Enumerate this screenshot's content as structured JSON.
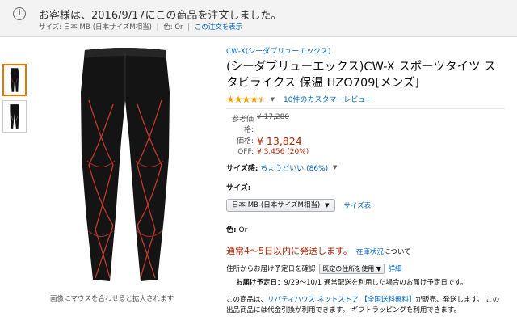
{
  "notice": {
    "icon": "info-icon",
    "message": "お客様は、2016/9/17にこの商品を注文しました。",
    "detail_size": "サイズ: 日本 MB-(日本サイズM相当)",
    "detail_sep": "|",
    "detail_color": "色: Or",
    "detail_link": "この注文を表示"
  },
  "gallery": {
    "hover_hint": "画像にマウスを合わせると拡大されます"
  },
  "product": {
    "brand": "CW-X(シーダブリューエックス)",
    "title": "(シーダブリューエックス)CW-X スポーツタイツ スタビライクス 保温 HZO709[メンズ]",
    "rating": 4.5,
    "reviews_text": "10件のカスタマーレビュー",
    "list_price_label": "参考価格:",
    "list_price": "¥ 17,280",
    "price_label": "価格:",
    "price": "¥ 13,824",
    "off_label": "OFF:",
    "off_value": "¥ 3,456 (20%)",
    "size_fit_label": "サイズ感:",
    "size_fit_value": "ちょうどいい (86%)",
    "size_label": "サイズ:",
    "size_selected": "日本 MB-(日本サイズM相当)",
    "size_chart_link": "サイズ表",
    "color_label": "色:",
    "color_value": "Or",
    "ship_message": "通常4～5日以内に発送します。",
    "stock_link": "在庫状況",
    "stock_tail": "について",
    "delivery_prefix": "住所からお届け予定日を確認",
    "delivery_select": "既定の住所を使用",
    "delivery_detail_link": "詳細",
    "delivery_date_label": "お届け予定日：",
    "delivery_date_text": "9/29～10/1 通常配送を利用した場合のお届け予定日です。",
    "seller_text_1": "この商品は、",
    "seller_name": "リバティハウス ネットストア",
    "seller_link2": "【全国送料無料】",
    "seller_text_2": "が販売、発送します。 この出品商品には代金引換が利用できます。 ギフトラッピングを利用できます。"
  },
  "colors": {
    "price": "#B12704",
    "link": "#0066C0",
    "star": "#F0A000",
    "thumb_active_border": "#E77600"
  }
}
